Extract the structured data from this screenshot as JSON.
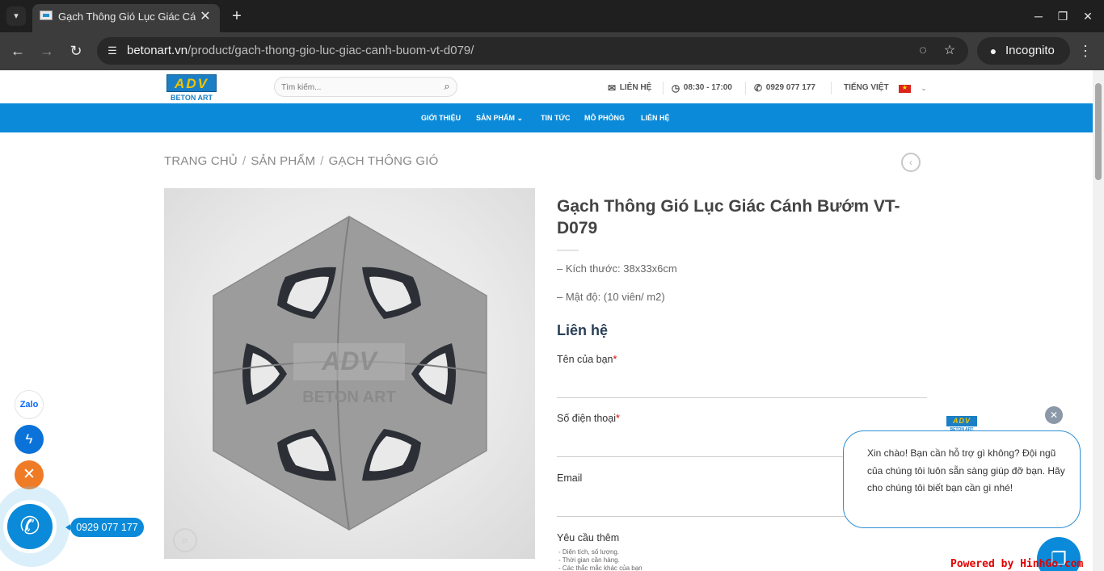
{
  "browser": {
    "tab_title": "Gạch Thông Gió Lục Giác Cá",
    "url_host": "betonart.vn",
    "url_path": "/product/gach-thong-gio-luc-giac-canh-buom-vt-d079/",
    "incognito_label": "Incognito",
    "icons": [
      "tab-search-icon",
      "close-icon",
      "plus-icon",
      "minimize-icon",
      "maximize-icon",
      "back-arrow-icon",
      "forward-arrow-icon",
      "reload-icon",
      "site-info-icon",
      "eye-off-icon",
      "star-icon",
      "incognito-icon",
      "kebab-menu-icon"
    ]
  },
  "header": {
    "logo_letters": "ADV",
    "logo_text": "BETON ART",
    "search_placeholder": "Tìm kiếm...",
    "contact_label": "LIÊN HỆ",
    "hours": "08:30 - 17:00",
    "phone": "0929 077 177",
    "language": "TIẾNG VIỆT"
  },
  "nav": {
    "items": [
      {
        "label": "GIỚI THIỆU"
      },
      {
        "label": "SẢN PHẨM"
      },
      {
        "label": "TIN TỨC"
      },
      {
        "label": "MÔ PHỎNG"
      },
      {
        "label": "LIÊN HỆ"
      }
    ]
  },
  "breadcrumb": {
    "items": [
      "TRANG CHỦ",
      "SẢN PHẨM",
      "GẠCH THÔNG GIÓ"
    ],
    "separator": "/"
  },
  "product": {
    "title": "Gạch Thông Gió Lục Giác Cánh Bướm VT-D079",
    "image_watermark_letters": "ADV",
    "image_watermark_text": "BETON ART",
    "specs": [
      "– Kích thước: 38x33x6cm",
      "– Mật độ: (10 viên/ m2)"
    ]
  },
  "contact_form": {
    "heading": "Liên hệ",
    "name_label": "Tên của bạn",
    "phone_label": "Số điện thoại",
    "email_label": "Email",
    "required_mark": "*",
    "extra_label": "Yêu cầu thêm",
    "hints": [
      "- Diện tích, số lượng.",
      "- Thời gian cần hàng.",
      "- Các thắc mắc khác của bạn"
    ]
  },
  "float_contact": {
    "zalo_label": "Zalo",
    "phone_number": "0929 077 177"
  },
  "chat": {
    "logo_letters": "ADV",
    "logo_text": "BETON ART",
    "message": "Xin chào! Bạn cần hỗ trợ gì không? Đội ngũ của chúng tôi luôn sẵn sàng giúp đỡ bạn. Hãy cho chúng tôi biết bạn cần gì nhé!"
  },
  "watermark": "Powered by HinhGo.com",
  "colors": {
    "nav_blue": "#0a8ad8",
    "title_gray": "#444444",
    "required_red": "#dd0000",
    "zalo_blue": "#0a68ff",
    "close_orange": "#f07b27"
  }
}
